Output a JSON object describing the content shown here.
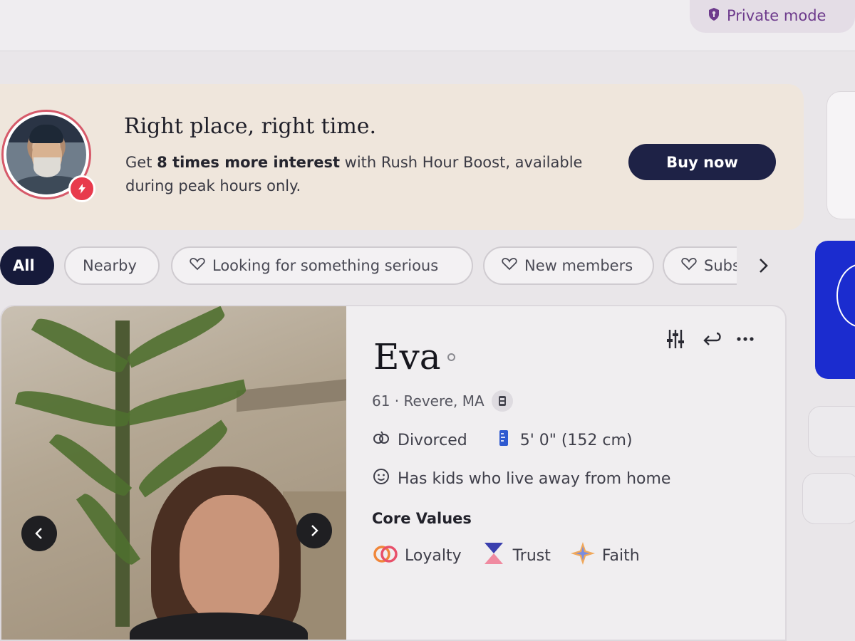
{
  "topbar": {
    "private_mode_label": "Private mode",
    "private_mode_icon": "shield-icon"
  },
  "banner": {
    "title": "Right place, right time.",
    "text_prefix": "Get ",
    "text_bold": "8 times more interest",
    "text_suffix": " with Rush Hour Boost, available during peak hours only.",
    "button_label": "Buy now",
    "badge_icon": "lightning-icon"
  },
  "filters": {
    "chips": [
      {
        "label": "All",
        "active": true
      },
      {
        "label": "Nearby",
        "active": false
      },
      {
        "label": "Looking for something serious",
        "active": false,
        "icon": "heart-outline-icon"
      },
      {
        "label": "New members",
        "active": false,
        "icon": "heart-outline-icon"
      },
      {
        "label": "Subs",
        "active": false,
        "icon": "heart-outline-icon"
      }
    ],
    "next_icon": "chevron-right-icon"
  },
  "profile": {
    "name": "Eva",
    "age_location": "61 · Revere, MA",
    "marital_status": "Divorced",
    "height": "5' 0\" (152 cm)",
    "kids": "Has kids who live away from home",
    "core_values_title": "Core Values",
    "core_values": [
      {
        "label": "Loyalty",
        "icon": "rings-icon"
      },
      {
        "label": "Trust",
        "icon": "hourglass-icon"
      },
      {
        "label": "Faith",
        "icon": "star-cross-icon"
      }
    ]
  },
  "colors": {
    "banner_bg": "#efe6dc",
    "button_bg": "#1e2246",
    "active_chip": "#161a3a",
    "boost_red": "#e83a4c",
    "private_purple": "#6d3a8c",
    "side_blue": "#1b2ccf"
  }
}
